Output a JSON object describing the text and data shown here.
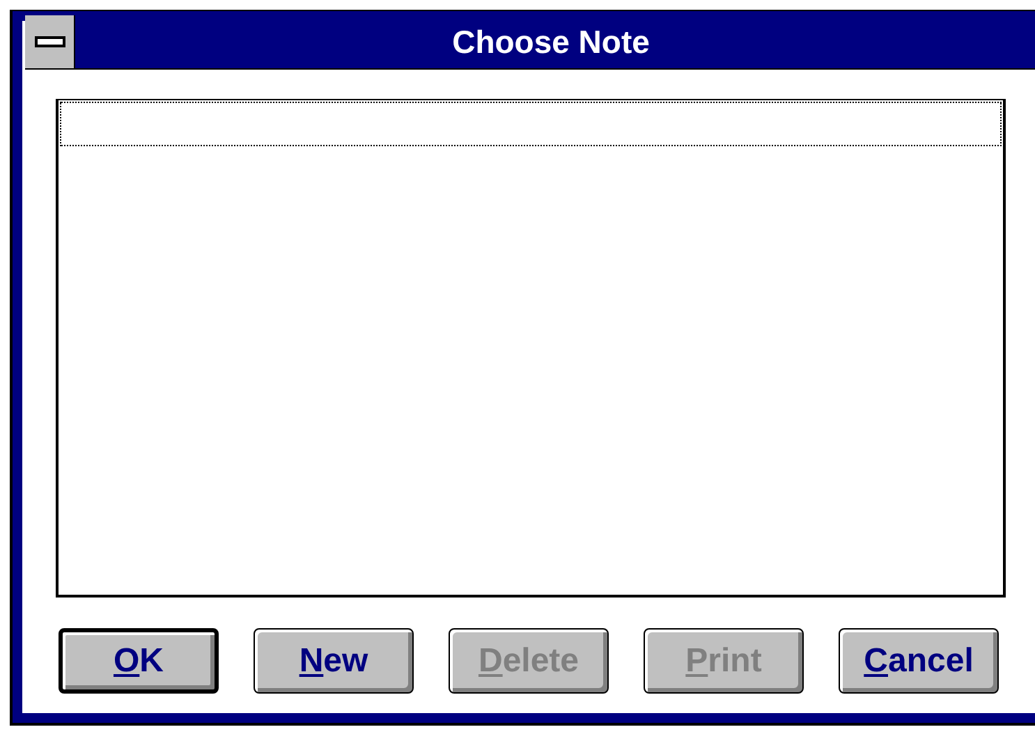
{
  "window": {
    "title": "Choose Note"
  },
  "list": {
    "focused": true
  },
  "buttons": [
    {
      "mnemonic": "O",
      "rest": "K",
      "default": true,
      "disabled": false
    },
    {
      "mnemonic": "N",
      "rest": "ew",
      "default": false,
      "disabled": false
    },
    {
      "mnemonic": "D",
      "rest": "elete",
      "default": false,
      "disabled": true
    },
    {
      "mnemonic": "P",
      "rest": "rint",
      "default": false,
      "disabled": true
    },
    {
      "mnemonic": "C",
      "rest": "ancel",
      "default": false,
      "disabled": false
    }
  ]
}
